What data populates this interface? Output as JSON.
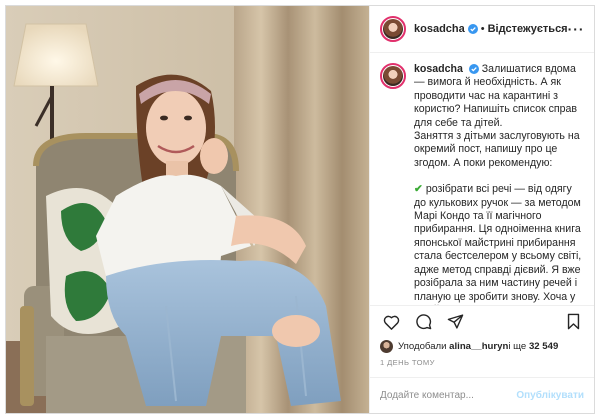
{
  "colors": {
    "accent": "#0095f6",
    "post_button_disabled": "#b2dffc",
    "story_ring": "#e1306c",
    "checkmark": "#3aaa35",
    "muted_text": "#8e8e8e"
  },
  "header": {
    "username": "kosadcha",
    "verified_icon": "verified-badge-icon",
    "separator": "•",
    "follow_status": "Відстежується",
    "more_icon": "more-options-icon",
    "more_label": "···"
  },
  "caption": {
    "username": "kosadcha",
    "paragraph_1": "Залишатися вдома — вимога й необхідність. А як проводити час на карантині з користю? Напишіть список справ для себе та дітей.",
    "paragraph_2": "Заняття з дітьми заслуговують на окремий пост, напишу про це згодом. А поки рекомендую:",
    "check_icon": "✔",
    "paragraph_3": "розібрати всі речі — від одягу до кулькових ручок — за методом Марі Кондо та її магічного прибирання. Ця одноіменна книга японської майстрині прибирання стала бестселером у всьому світі, адже метод справді дієвий. Я вже розібрала за ним частину речей і планую це зробити знову. Хоча у своїй книзі Марі дає на це пів року,"
  },
  "actions": {
    "like_icon": "heart-icon",
    "comment_icon": "comment-icon",
    "share_icon": "share-icon",
    "save_icon": "bookmark-icon"
  },
  "likes": {
    "prefix": "Уподобали ",
    "user": "alina__huryn",
    "middle": " і ще ",
    "count": "32 549"
  },
  "date": "1 ДЕНЬ ТОМУ",
  "composer": {
    "placeholder": "Додайте коментар...",
    "post_label": "Опублікувати"
  }
}
